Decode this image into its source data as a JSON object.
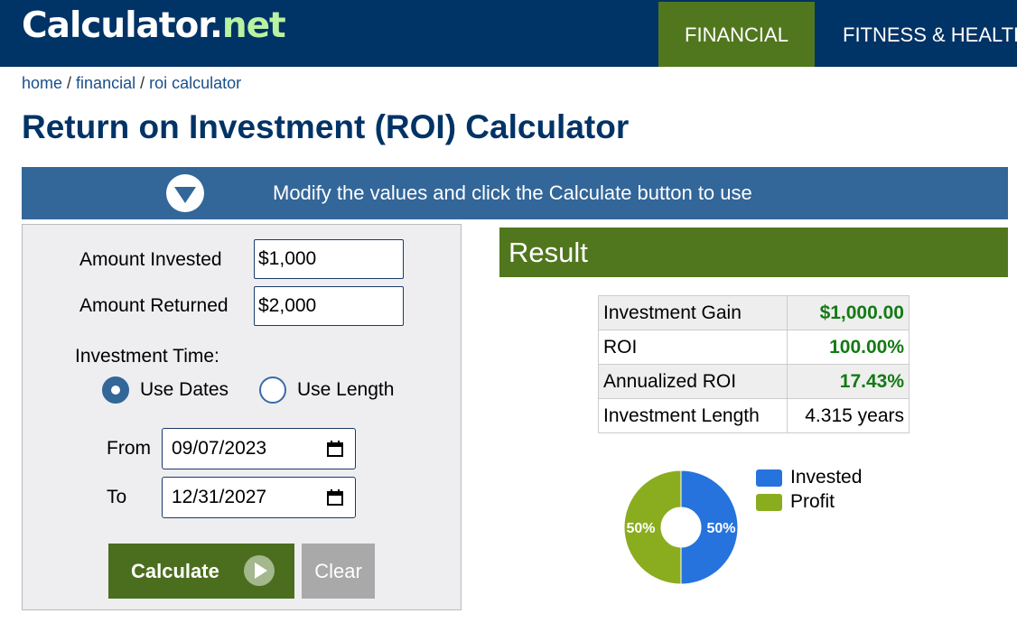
{
  "header": {
    "logo_part1": "Calculator",
    "logo_part2": ".",
    "logo_part3": "net",
    "nav_financial": "FINANCIAL",
    "nav_fitness": "FITNESS & HEALTH"
  },
  "breadcrumb": {
    "home": "home",
    "sep": " / ",
    "financial": "financial",
    "current": "roi calculator"
  },
  "page_title": "Return on Investment (ROI) Calculator",
  "modify_bar": {
    "text": "Modify the values and click the Calculate button to use",
    "icon": "chevron-down-circle-icon"
  },
  "form": {
    "amount_invested_label": "Amount Invested",
    "amount_invested_value": "$1,000",
    "amount_returned_label": "Amount Returned",
    "amount_returned_value": "$2,000",
    "investment_time_label": "Investment Time:",
    "use_dates_label": "Use Dates",
    "use_length_label": "Use Length",
    "selected_mode": "Use Dates",
    "from_label": "From",
    "from_value": "09/07/2023",
    "to_label": "To",
    "to_value": "12/31/2027",
    "calculate_label": "Calculate",
    "clear_label": "Clear"
  },
  "result": {
    "title": "Result",
    "rows": [
      {
        "label": "Investment Gain",
        "value": "$1,000.00"
      },
      {
        "label": "ROI",
        "value": "100.00%"
      },
      {
        "label": "Annualized ROI",
        "value": "17.43%"
      },
      {
        "label": "Investment Length",
        "value": "4.315 years"
      }
    ],
    "pie": {
      "slices": [
        {
          "name": "Invested",
          "value": 50,
          "label": "50%",
          "color": "#2673dd"
        },
        {
          "name": "Profit",
          "value": 50,
          "label": "50%",
          "color": "#8aad1f"
        }
      ]
    }
  },
  "colors": {
    "header_bg": "#003366",
    "accent_green": "#51771e",
    "modify_bar_bg": "#336699",
    "value_green": "#137a13"
  }
}
